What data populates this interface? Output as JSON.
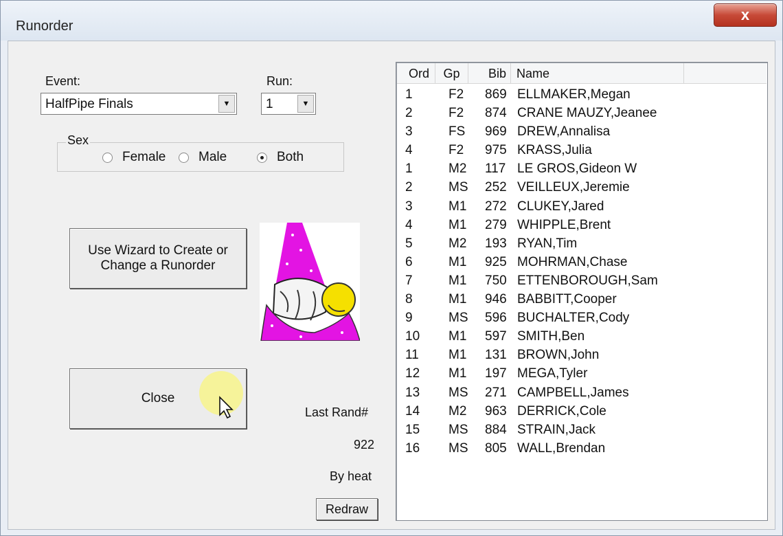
{
  "window": {
    "title": "Runorder",
    "close_glyph": "x"
  },
  "event": {
    "label": "Event:",
    "value": "HalfPipe Finals"
  },
  "run": {
    "label": "Run:",
    "value": "1"
  },
  "sex": {
    "legend": "Sex",
    "options": [
      {
        "label": "Female",
        "selected": false
      },
      {
        "label": "Male",
        "selected": false
      },
      {
        "label": "Both",
        "selected": true
      }
    ]
  },
  "wizard_button": {
    "line1": "Use Wizard to Create or",
    "line2": "Change a Runorder"
  },
  "close_button": {
    "label": "Close"
  },
  "rand": {
    "label": "Last Rand#",
    "value": "922",
    "mode": "By heat"
  },
  "redraw_button": {
    "label": "Redraw"
  },
  "table": {
    "columns": [
      "Ord",
      "Gp",
      "Bib",
      "Name"
    ],
    "rows": [
      [
        "1",
        "F2",
        "869",
        "ELLMAKER,Megan"
      ],
      [
        "2",
        "F2",
        "874",
        "CRANE MAUZY,Jeanee"
      ],
      [
        "3",
        "FS",
        "969",
        "DREW,Annalisa"
      ],
      [
        "4",
        "F2",
        "975",
        "KRASS,Julia"
      ],
      [
        "1",
        "M2",
        "117",
        "LE GROS,Gideon W"
      ],
      [
        "2",
        "MS",
        "252",
        "VEILLEUX,Jeremie"
      ],
      [
        "3",
        "M1",
        "272",
        "CLUKEY,Jared"
      ],
      [
        "4",
        "M1",
        "279",
        "WHIPPLE,Brent"
      ],
      [
        "5",
        "M2",
        "193",
        "RYAN,Tim"
      ],
      [
        "6",
        "M1",
        "925",
        "MOHRMAN,Chase"
      ],
      [
        "7",
        "M1",
        "750",
        "ETTENBOROUGH,Sam"
      ],
      [
        "8",
        "M1",
        "946",
        "BABBITT,Cooper"
      ],
      [
        "9",
        "MS",
        "596",
        "BUCHALTER,Cody"
      ],
      [
        "10",
        "M1",
        "597",
        "SMITH,Ben"
      ],
      [
        "11",
        "M1",
        "131",
        "BROWN,John"
      ],
      [
        "12",
        "M1",
        "197",
        "MEGA,Tyler"
      ],
      [
        "13",
        "MS",
        "271",
        "CAMPBELL,James"
      ],
      [
        "14",
        "M2",
        "963",
        "DERRICK,Cole"
      ],
      [
        "15",
        "MS",
        "884",
        "STRAIN,Jack"
      ],
      [
        "16",
        "MS",
        "805",
        "WALL,Brendan"
      ]
    ]
  }
}
